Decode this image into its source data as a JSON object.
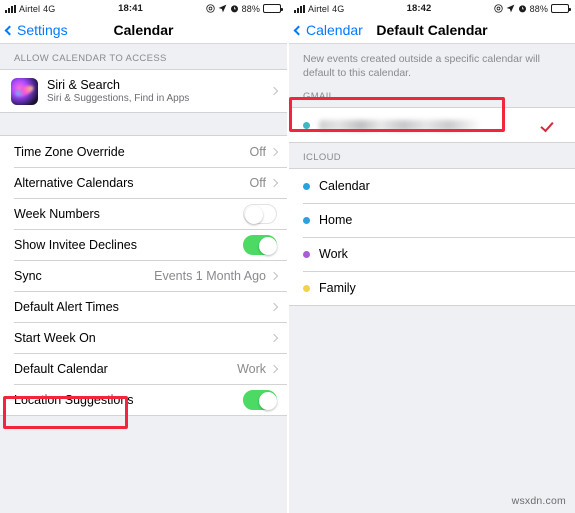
{
  "left_panel": {
    "status_bar": {
      "carrier": "Airtel",
      "network": "4G",
      "time": "18:41",
      "battery_percent": "88%",
      "icons": [
        "signal-bars-icon",
        "do-not-disturb-icon",
        "location-arrow-icon",
        "alarm-clock-icon",
        "battery-icon"
      ]
    },
    "nav": {
      "back_label": "Settings",
      "title": "Calendar"
    },
    "access_section": {
      "header": "ALLOW CALENDAR TO ACCESS",
      "siri": {
        "title": "Siri & Search",
        "subtitle": "Siri & Suggestions, Find in Apps"
      }
    },
    "settings_rows": [
      {
        "label": "Time Zone Override",
        "value": "Off",
        "type": "disclosure"
      },
      {
        "label": "Alternative Calendars",
        "value": "Off",
        "type": "disclosure"
      },
      {
        "label": "Week Numbers",
        "value": "",
        "type": "toggle",
        "on": false
      },
      {
        "label": "Show Invitee Declines",
        "value": "",
        "type": "toggle",
        "on": true
      },
      {
        "label": "Sync",
        "value": "Events 1 Month Ago",
        "type": "disclosure"
      },
      {
        "label": "Default Alert Times",
        "value": "",
        "type": "disclosure"
      },
      {
        "label": "Start Week On",
        "value": "",
        "type": "disclosure"
      },
      {
        "label": "Default Calendar",
        "value": "Work",
        "type": "disclosure",
        "highlighted": true
      },
      {
        "label": "Location Suggestions",
        "value": "",
        "type": "toggle",
        "on": true
      }
    ]
  },
  "right_panel": {
    "status_bar": {
      "carrier": "Airtel",
      "network": "4G",
      "time": "18:42",
      "battery_percent": "88%"
    },
    "nav": {
      "back_label": "Calendar",
      "title": "Default Calendar"
    },
    "footnote": "New events created outside a specific calendar will default to this calendar.",
    "gmail_section": {
      "header": "GMAIL",
      "row": {
        "label": "",
        "redacted": true,
        "dot_color": "#3fb8c4",
        "selected": true,
        "highlighted": true
      }
    },
    "icloud_section": {
      "header": "ICLOUD",
      "rows": [
        {
          "label": "Calendar",
          "dot_color": "#2e9fe0",
          "selected": false
        },
        {
          "label": "Home",
          "dot_color": "#2e9fe0",
          "selected": false
        },
        {
          "label": "Work",
          "dot_color": "#a95fd0",
          "selected": false
        },
        {
          "label": "Family",
          "dot_color": "#f2d24b",
          "selected": false
        }
      ]
    }
  },
  "annotations": {
    "highlight_color": "#f3253c",
    "checkmark_color": "#cf2b3a"
  },
  "watermark": "wsxdn.com"
}
